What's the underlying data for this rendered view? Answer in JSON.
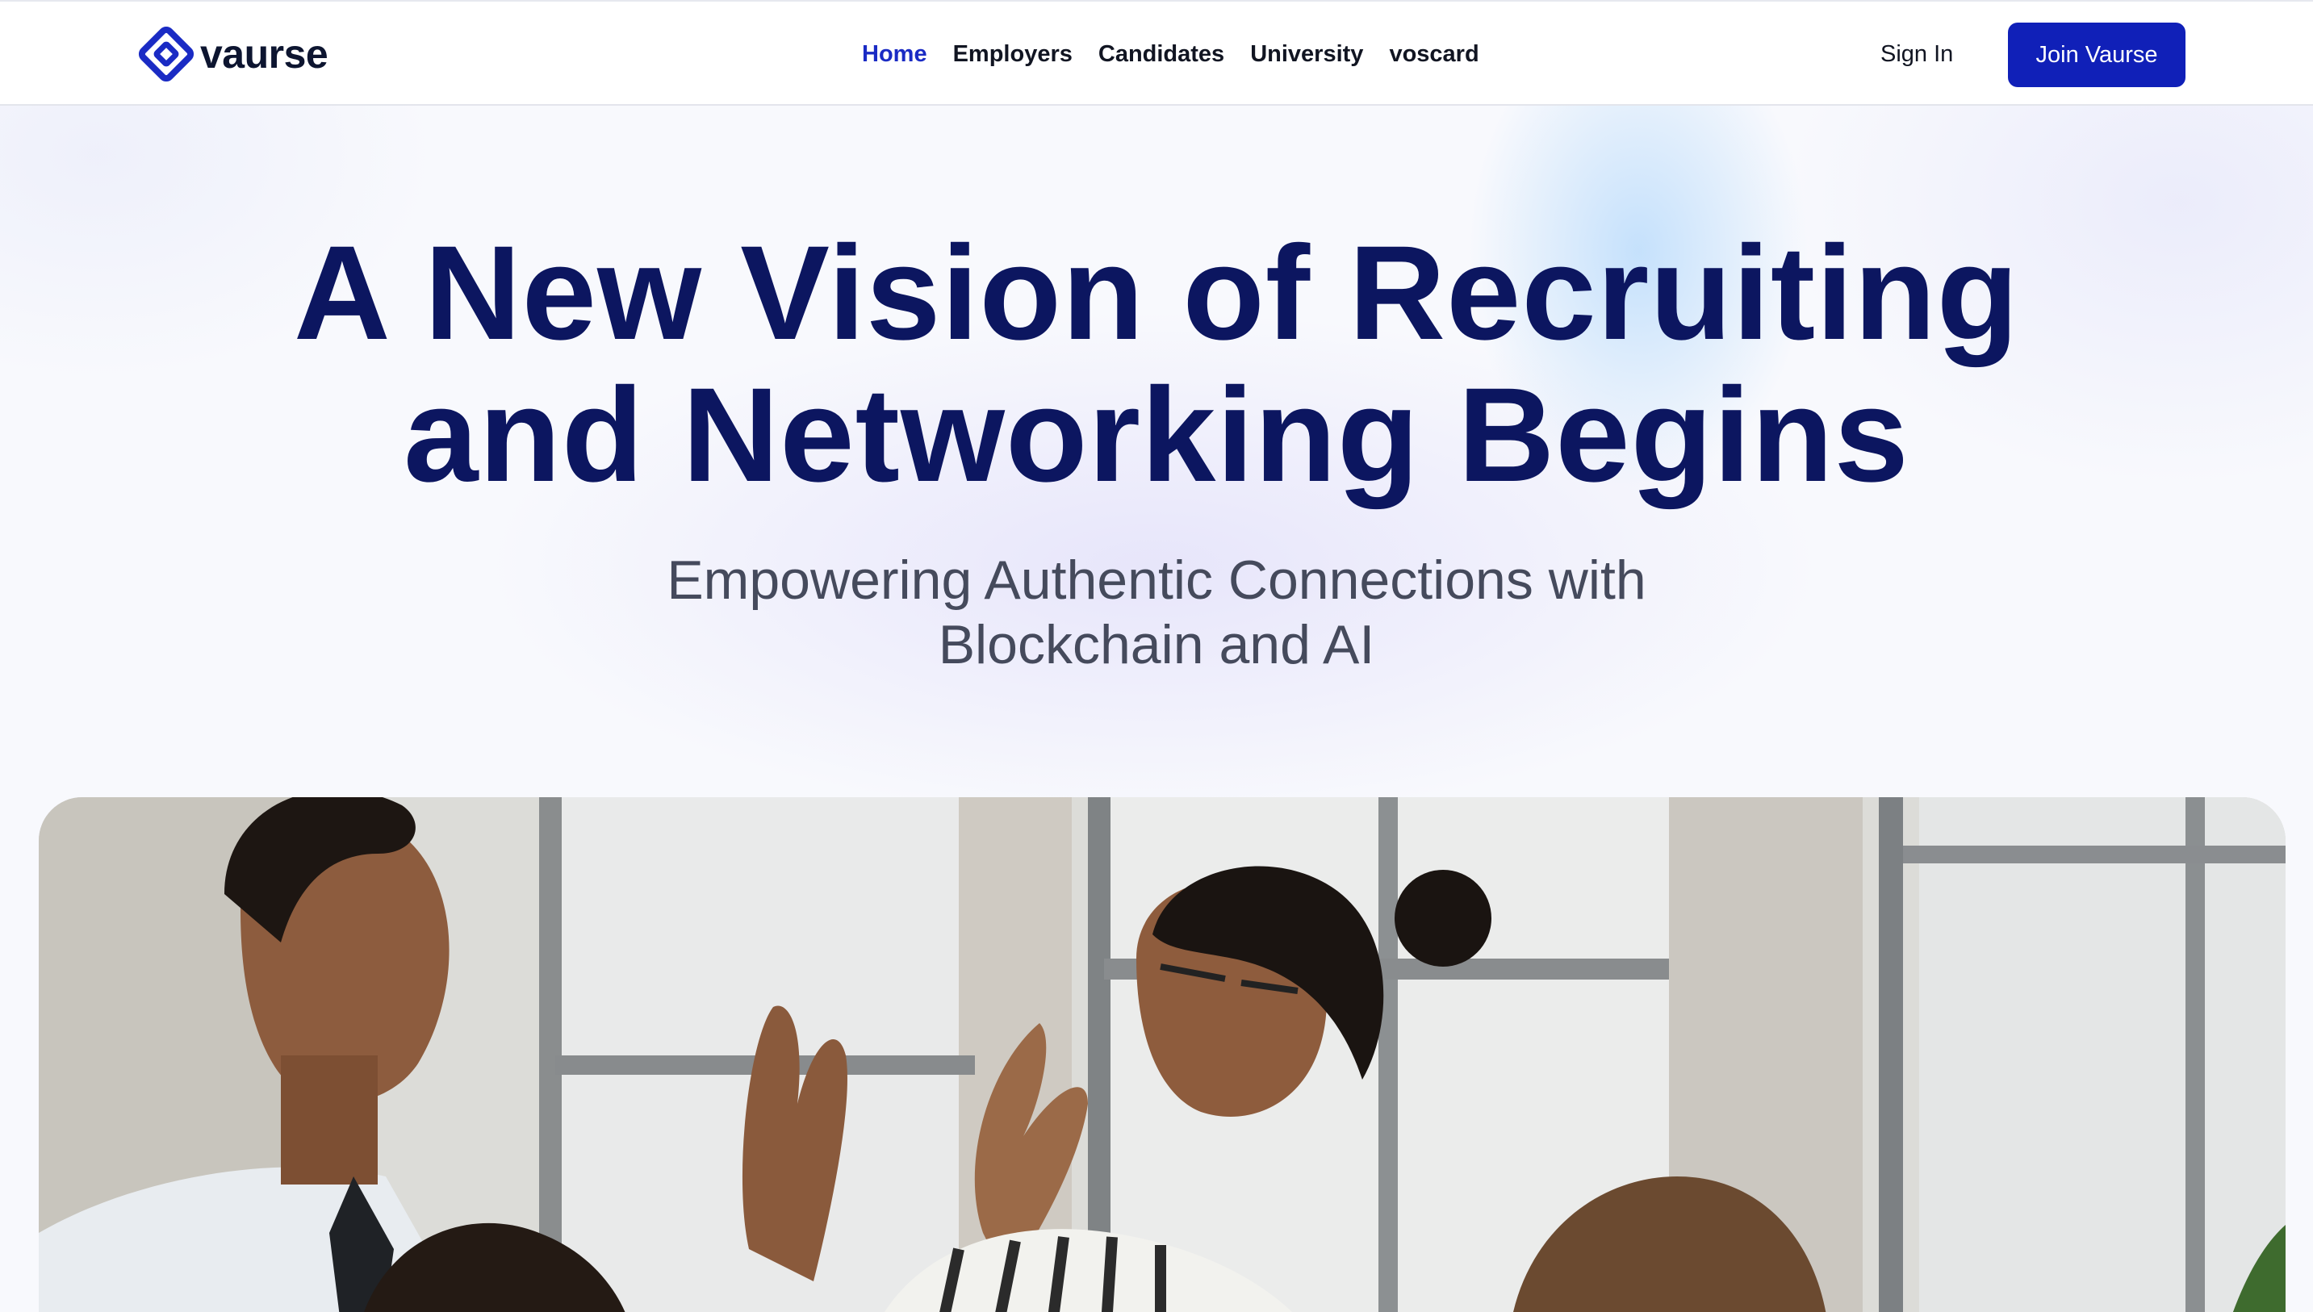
{
  "brand": {
    "name": "vaurse",
    "logo_icon": "diamond-logo-icon",
    "accent": "#1020b8"
  },
  "nav": {
    "links": [
      {
        "label": "Home",
        "active": true
      },
      {
        "label": "Employers",
        "active": false
      },
      {
        "label": "Candidates",
        "active": false
      },
      {
        "label": "University",
        "active": false
      },
      {
        "label": "voscard",
        "active": false
      }
    ],
    "sign_in": "Sign In",
    "join": "Join Vaurse"
  },
  "hero": {
    "headline_line1": "A New Vision of Recruiting",
    "headline_line2": "and Networking Begins",
    "subhead_line1": "Empowering Authentic Connections with",
    "subhead_line2": "Blockchain and AI",
    "headline_color": "#0c1660"
  },
  "photo": {
    "subject": "office-team-high-five-photo"
  }
}
